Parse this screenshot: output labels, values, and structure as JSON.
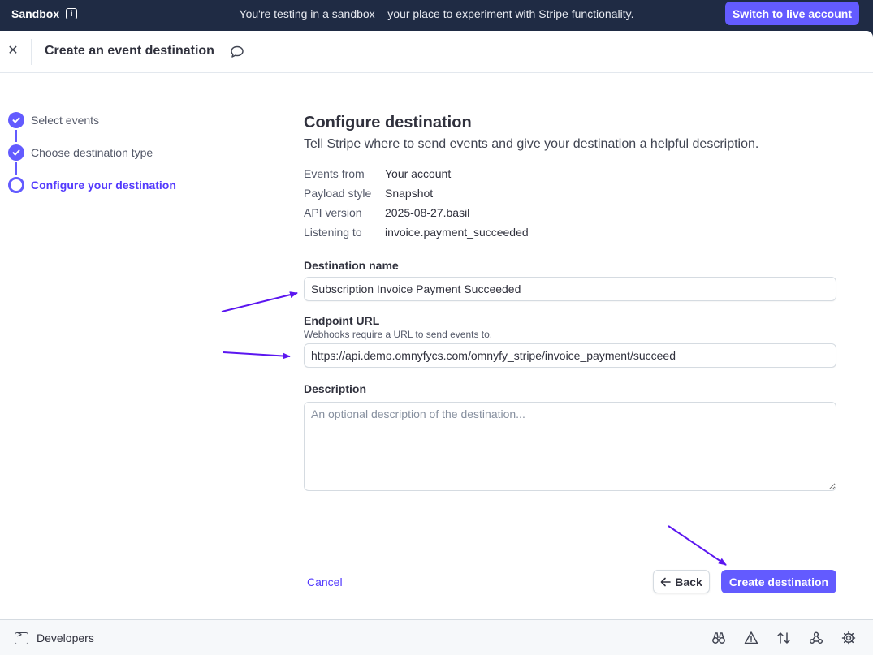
{
  "topbar": {
    "sandbox_label": "Sandbox",
    "message": "You're testing in a sandbox – your place to experiment with Stripe functionality.",
    "live_button": "Switch to live account"
  },
  "header": {
    "title": "Create an event destination"
  },
  "steps": [
    {
      "label": "Select events",
      "state": "done"
    },
    {
      "label": "Choose destination type",
      "state": "done"
    },
    {
      "label": "Configure your destination",
      "state": "current"
    }
  ],
  "form": {
    "heading": "Configure destination",
    "subheading": "Tell Stripe where to send events and give your destination a helpful description.",
    "meta": [
      {
        "key": "Events from",
        "value": "Your account"
      },
      {
        "key": "Payload style",
        "value": "Snapshot"
      },
      {
        "key": "API version",
        "value": "2025-08-27.basil"
      },
      {
        "key": "Listening to",
        "value": "invoice.payment_succeeded"
      }
    ],
    "name_label": "Destination name",
    "name_value": "Subscription Invoice Payment Succeeded",
    "url_label": "Endpoint URL",
    "url_help": "Webhooks require a URL to send events to.",
    "url_value": "https://api.demo.omnyfycs.com/omnyfy_stripe/invoice_payment/succeed",
    "description_label": "Description",
    "description_placeholder": "An optional description of the destination..."
  },
  "actions": {
    "cancel": "Cancel",
    "back": "Back",
    "create": "Create destination"
  },
  "footer": {
    "developers": "Developers"
  },
  "colors": {
    "accent": "#635bff",
    "annotation_arrow": "#5b16f0",
    "topbar": "#1f2b44"
  },
  "icons": [
    "info-icon",
    "close-icon",
    "feedback-icon",
    "check-icon",
    "arrow-left-icon",
    "terminal-icon",
    "binoculars-icon",
    "warning-icon",
    "sort-arrows-icon",
    "webhook-icon",
    "gear-icon"
  ]
}
